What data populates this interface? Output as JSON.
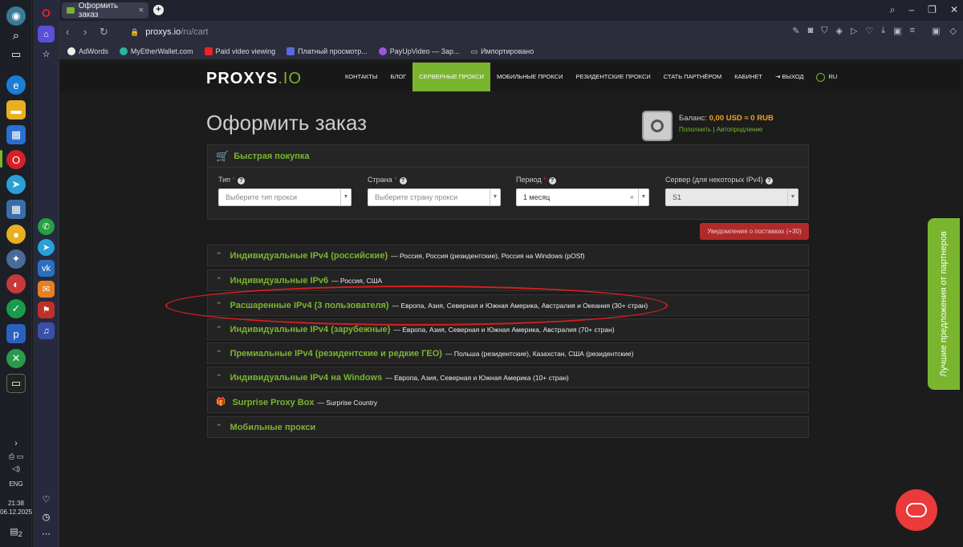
{
  "browser": {
    "tab_title": "Оформить заказ",
    "url_host": "proxys.io",
    "url_path": "/ru/cart",
    "bookmarks": [
      "AdWords",
      "MyEtherWallet.com",
      "Paid video viewing",
      "Платный просмотр...",
      "PayUpVideo — Зар...",
      "Импортировано"
    ]
  },
  "taskbar": {
    "lang": "ENG",
    "time": "21:38",
    "date": "06.12.2025",
    "notif_count": "2"
  },
  "site": {
    "logo_main": "PROXYS",
    "logo_suffix": ".IO",
    "nav": [
      "КОНТАКТЫ",
      "БЛОГ",
      "СЕРВЕРНЫЕ ПРОКСИ",
      "МОБИЛЬНЫЕ ПРОКСИ",
      "РЕЗИДЕНТСКИЕ ПРОКСИ",
      "СТАТЬ ПАРТНЁРОМ",
      "КАБИНЕТ",
      "ВЫХОД",
      "RU"
    ]
  },
  "page": {
    "title": "Оформить заказ",
    "balance_label": "Баланс:",
    "balance_value": "0,00 USD ≈ 0 RUB",
    "topup": "Пополнить",
    "sep": "|",
    "autotopup": "Автопродление"
  },
  "quick": {
    "title": "Быстрая покупка",
    "fields": [
      {
        "label": "Тип",
        "req": "*",
        "value": "Выберите тип прокси"
      },
      {
        "label": "Страна",
        "req": "*",
        "value": "Выберите страну прокси"
      },
      {
        "label": "Период",
        "req": "*",
        "value": "1 месяц"
      },
      {
        "label": "Сервер (для некоторых IPv4)",
        "value": "S1"
      }
    ]
  },
  "notify_button": "Уведомления о поставках (+30)",
  "categories": [
    {
      "name": "Индивидуальные IPv4 (российские)",
      "desc": "— Россия, Россия (резидентские), Россия на Windows (pOSf)"
    },
    {
      "name": "Индивидуальные IPv6",
      "desc": "— Россия, США"
    },
    {
      "name": "Расшаренные IPv4 (3 пользователя)",
      "desc": "— Европа, Азия, Северная и Южная Америка, Австралия и Океания (30+ стран)"
    },
    {
      "name": "Индивидуальные IPv4 (зарубежные)",
      "desc": "— Европа, Азия, Северная и Южная Америка, Австралия (70+ стран)"
    },
    {
      "name": "Премиальные IPv4 (резидентские и редкие ГЕО)",
      "desc": "— Польша (резидентские), Казахстан, США (резидентские)"
    },
    {
      "name": "Индивидуальные IPv4 на Windows",
      "desc": "— Европа, Азия, Северная и Южная Америка (10+ стран)"
    },
    {
      "name": "Surprise Proxy Box",
      "desc": "— Surprise Country"
    },
    {
      "name": "Мобильные прокси",
      "desc": ""
    }
  ],
  "partner_tab": "Лучшие предложения от партнеров",
  "colors": {
    "accent": "#7ab530",
    "danger": "#d81e1e",
    "balance": "#f0a020"
  }
}
